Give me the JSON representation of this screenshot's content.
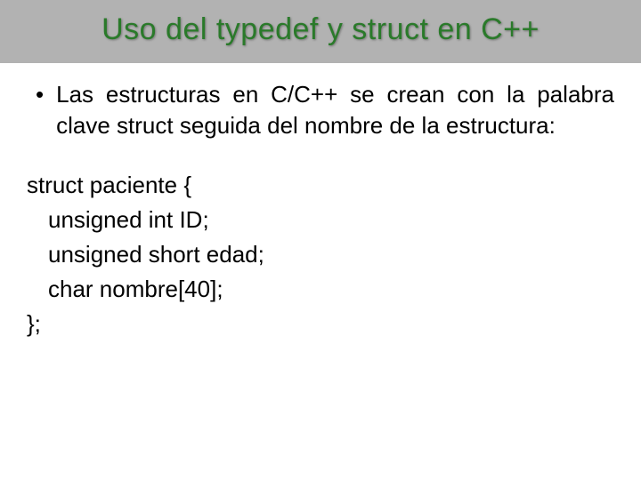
{
  "title": "Uso del typedef y struct en C++",
  "bullet": {
    "text": "Las estructuras en C/C++ se crean con la palabra clave struct seguida del nombre de la estructura:"
  },
  "code": {
    "line1": "struct paciente {",
    "line2": "unsigned int ID;",
    "line3": "unsigned short edad;",
    "line4": "char nombre[40];",
    "line5": "};"
  }
}
